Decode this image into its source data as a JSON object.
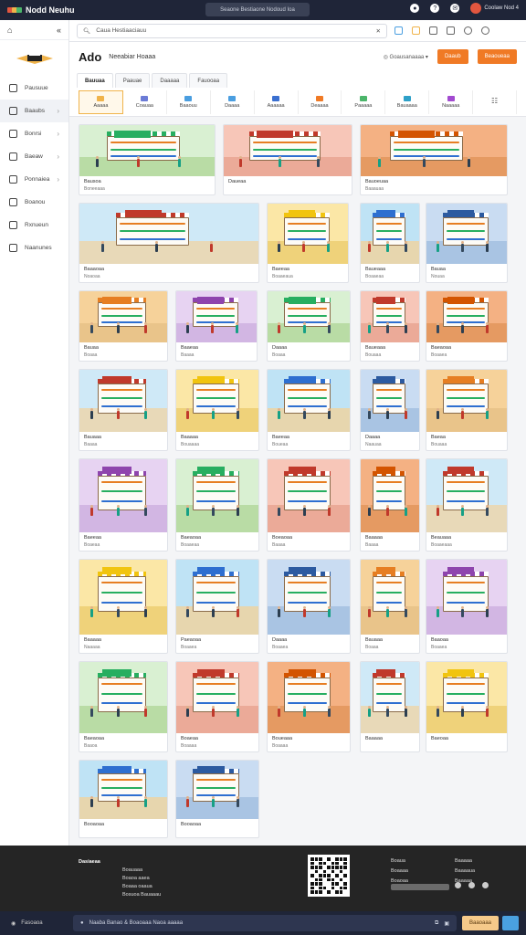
{
  "topbar": {
    "brand": "Nodd Neuhu",
    "search_placeholder": "Seaone Bestiaone Nodoud Ioa",
    "user_label": "Coolaw Nod 4"
  },
  "sidebar": {
    "items": [
      {
        "label": "Pausuue",
        "icon": "grid-icon"
      },
      {
        "label": "Baaubs",
        "icon": "list-icon",
        "chev": true
      },
      {
        "label": "Bonrsi",
        "icon": "box-icon",
        "chev": true
      },
      {
        "label": "Baeaw",
        "icon": "tag-icon",
        "chev": true
      },
      {
        "label": "Ponnaiea",
        "icon": "store-icon",
        "chev": true
      },
      {
        "label": "Boanou",
        "icon": "user-icon"
      },
      {
        "label": "Rxnueun",
        "icon": "chart-icon"
      },
      {
        "label": "Naanunes",
        "icon": "settings-icon"
      }
    ]
  },
  "addressbar": {
    "value": "Caua Hestiaaciauu"
  },
  "header": {
    "title": "Ado",
    "subtitle": "Neeabiar Hoaaa",
    "meta": "Goausanaaaa",
    "btn1": "Daaub",
    "btn2": "Beaoueaa"
  },
  "tabs": [
    "Bauuaa",
    "Paauae",
    "Daaaaa",
    "Fauooaa"
  ],
  "categories": [
    {
      "label": "Aaaaa",
      "top": "AuU",
      "color": "#f0b34a"
    },
    {
      "label": "Coauaa",
      "color": "#6b7bd6"
    },
    {
      "label": "Baaouu",
      "color": "#4a9ee0"
    },
    {
      "label": "Daaaa",
      "color": "#4a9ee0"
    },
    {
      "label": "Aaaaaa",
      "color": "#3a6fd0"
    },
    {
      "label": "Deaaaa",
      "color": "#f07a25"
    },
    {
      "label": "Paaaaa",
      "color": "#4bb56a"
    },
    {
      "label": "Bauaaaa",
      "color": "#2ea0c8"
    },
    {
      "label": "Naaaaa",
      "color": "#a24ad0"
    },
    {
      "label": "",
      "color": "#777"
    }
  ],
  "cards": [
    {
      "t": "Bausoa",
      "s": "Boneeaaa"
    },
    {
      "t": "Daueaa",
      "s": ""
    },
    {
      "t": "Bauoeuaa",
      "s": "Baaauaa"
    },
    {
      "t": "Baaaoaa",
      "s": "Noaoaa"
    },
    {
      "t": "Baeeaa",
      "s": "Boaaeaua"
    },
    {
      "t": "Baueaaa",
      "s": "Boaaeaa"
    },
    {
      "t": "Bauaa",
      "s": "Nouaa"
    },
    {
      "t": "Bauaa",
      "s": "Boaaa"
    },
    {
      "t": "Baaeaa",
      "s": "Baaaa"
    },
    {
      "t": "Daaaa",
      "s": "Boaaa"
    },
    {
      "t": "Baueaaa",
      "s": "Bouaaa"
    },
    {
      "t": "Baeaoaa",
      "s": "Boaaea"
    },
    {
      "t": "Bauaaa",
      "s": "Baaaa"
    },
    {
      "t": "Baaaaa",
      "s": "Bouaaaa"
    },
    {
      "t": "Baeeaa",
      "s": "Boueaa"
    },
    {
      "t": "Daaaa",
      "s": "Naauaa"
    },
    {
      "t": "Baeaa",
      "s": "Bouaaa"
    },
    {
      "t": "Baeeaa",
      "s": "Boaeaa"
    },
    {
      "t": "Baeaoaa",
      "s": "Boaaeaa"
    },
    {
      "t": "Boeaoaa",
      "s": "Baaaa"
    },
    {
      "t": "Baaaaa",
      "s": "Baaaa"
    },
    {
      "t": "Beauaaa",
      "s": "Boaaeaaa"
    },
    {
      "t": "Baaaaa",
      "s": "Naaaaa"
    },
    {
      "t": "Paeaoaa",
      "s": "Boaaea"
    },
    {
      "t": "Daaaa",
      "s": "Boaaea"
    },
    {
      "t": "Bauaaa",
      "s": "Boaaa"
    },
    {
      "t": "Baaoaa",
      "s": "Boaaea"
    },
    {
      "t": "Baeaoaa",
      "s": "Baaoa"
    },
    {
      "t": "Boaeaa",
      "s": "Boaaaa"
    },
    {
      "t": "Boueaaa",
      "s": "Boaaaa"
    },
    {
      "t": "Baaaaa",
      "s": ""
    },
    {
      "t": "Baeoaa",
      "s": ""
    },
    {
      "t": "Booaoaa",
      "s": ""
    },
    {
      "t": "Booaoaa",
      "s": ""
    }
  ],
  "footer": {
    "col1_title": "Dasiaeaa",
    "col1": [
      "Boauaaa",
      "Boaoa aaea",
      "Boaaa oaaua",
      "Bosuoa Bauaaau"
    ],
    "col3": [
      "Boaua",
      "Boaaaa",
      "Boaoaa"
    ],
    "col4": [
      "Baaaaa",
      "Baaaaua",
      "Baaaaa"
    ]
  },
  "bottombar": {
    "left": "Fasoaoa",
    "input": "Naaba Banao & Boaoaaa Naoa aaaaa",
    "btn": "Baaoaaa"
  }
}
